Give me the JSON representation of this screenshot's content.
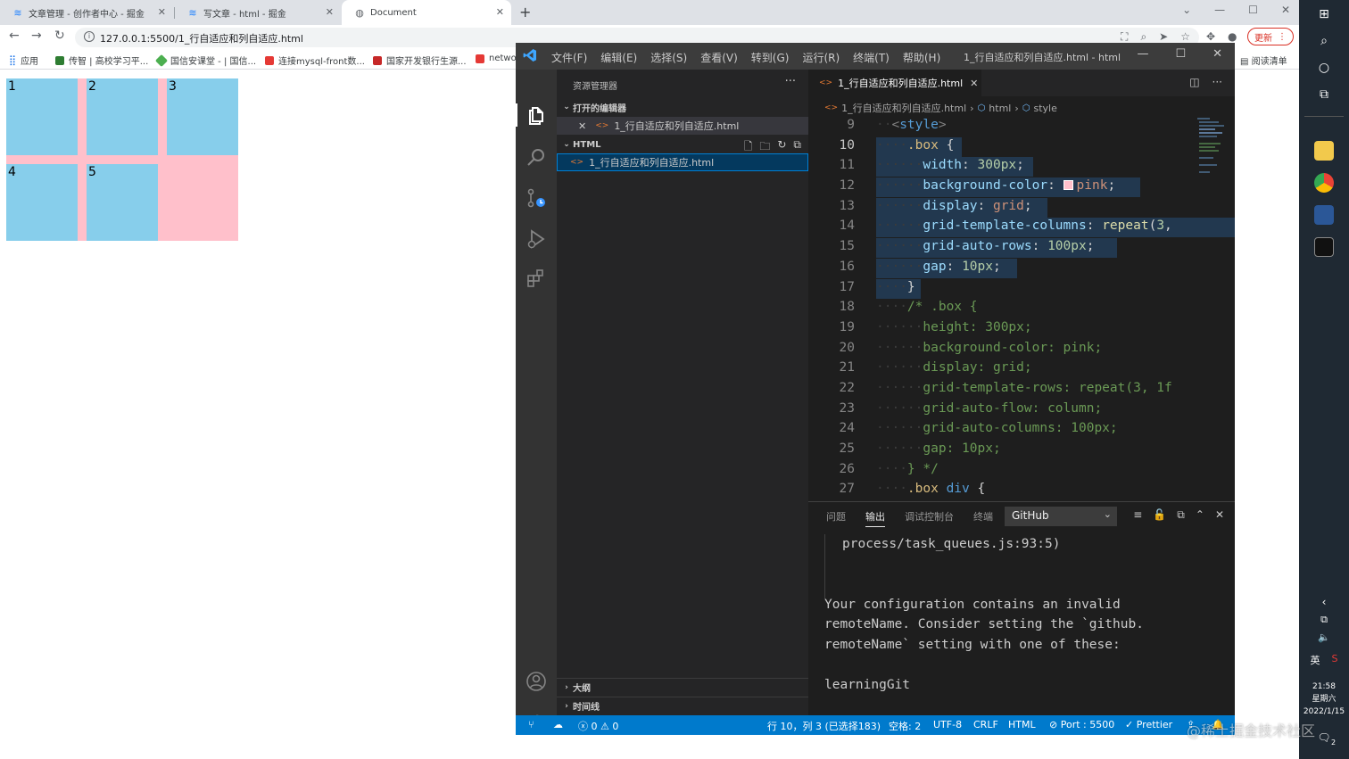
{
  "browser": {
    "tabs": [
      {
        "title": "文章管理 - 创作者中心 - 掘金"
      },
      {
        "title": "写文章 - html - 掘金"
      },
      {
        "title": "Document"
      }
    ],
    "url": "127.0.0.1:5500/1_行自适应和列自适应.html",
    "update_label": "更新",
    "bookmarks": [
      "应用",
      "传智 | 高校学习平...",
      "国信安课堂 - | 国信...",
      "连接mysql-front数...",
      "国家开发银行生源...",
      "netwo"
    ],
    "reading_list": "阅读清单"
  },
  "page": {
    "cells": [
      "1",
      "2",
      "3",
      "4",
      "5"
    ]
  },
  "vscode": {
    "menu": [
      "文件(F)",
      "编辑(E)",
      "选择(S)",
      "查看(V)",
      "转到(G)",
      "运行(R)",
      "终端(T)",
      "帮助(H)"
    ],
    "window_title": "1_行自适应和列自适应.html - html",
    "explorer_title": "资源管理器",
    "open_editors_label": "打开的编辑器",
    "open_file": "1_行自适应和列自适应.html",
    "folder_label": "HTML",
    "folder_file": "1_行自适应和列自适应.html",
    "outline_label": "大纲",
    "timeline_label": "时间线",
    "editor_tab": "1_行自适应和列自适应.html",
    "breadcrumb": [
      "1_行自适应和列自适应.html",
      "html",
      "style"
    ],
    "line_numbers": [
      "9",
      "10",
      "11",
      "12",
      "13",
      "14",
      "15",
      "16",
      "17",
      "18",
      "19",
      "20",
      "21",
      "22",
      "23",
      "24",
      "25",
      "26",
      "27"
    ],
    "current_line": "10",
    "panel_tabs": [
      "问题",
      "输出",
      "调试控制台",
      "终端"
    ],
    "panel_active": "输出",
    "output_channel": "GitHub",
    "output_lines": [
      "process/task_queues.js:93:5)",
      "",
      "",
      "Your configuration contains an invalid",
      "remoteName. Consider setting the `github.",
      "remoteName` setting with one of these:",
      "",
      "learningGit"
    ],
    "status": {
      "errors": "0",
      "warnings": "0",
      "position": "行 10，列 3 (已选择183)",
      "spaces": "空格: 2",
      "encoding": "UTF-8",
      "eol": "CRLF",
      "language": "HTML",
      "port": "Port : 5500",
      "prettier": "Prettier"
    }
  },
  "taskbar": {
    "ime": "英",
    "time": "21:58",
    "weekday": "星期六",
    "date": "2022/1/15",
    "notification_count": "2"
  },
  "watermark": "@稀土掘金技术社区",
  "colors": {
    "page_cell": "#87ceeb",
    "page_bg": "#ffc0cb",
    "vscode_status": "#007acc",
    "update_red": "#d93025"
  }
}
